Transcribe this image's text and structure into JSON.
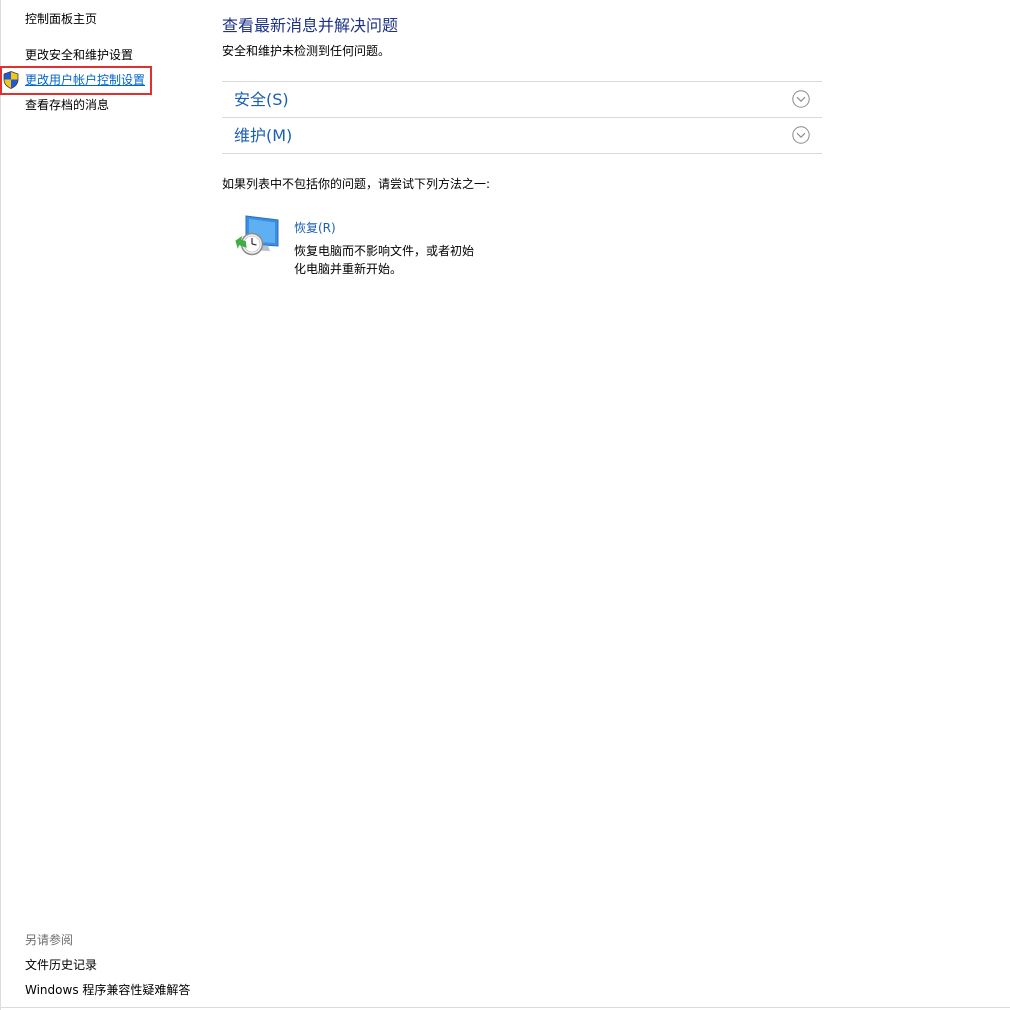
{
  "nav": {
    "home": "控制面板主页",
    "security_settings": "更改安全和维护设置",
    "uac_settings": "更改用户帐户控制设置",
    "archived_messages": "查看存档的消息"
  },
  "see_also": {
    "title": "另请参阅",
    "items": [
      "文件历史记录",
      "Windows 程序兼容性疑难解答"
    ]
  },
  "main": {
    "title": "查看最新消息并解决问题",
    "subtitle": "安全和维护未检测到任何问题。",
    "sections": [
      {
        "label": "安全(S)"
      },
      {
        "label": "维护(M)"
      }
    ],
    "help_text": "如果列表中不包括你的问题，请尝试下列方法之一:",
    "recovery": {
      "link": "恢复(R)",
      "description": "恢复电脑而不影响文件，或者初始化电脑并重新开始。"
    }
  },
  "colors": {
    "link": "#1a5fb4",
    "title": "#1e3287",
    "highlight": "#e0312f",
    "muted": "#6d6d6d"
  },
  "icons": {
    "uac": "uac-shield-icon",
    "expand": "chevron-down-circle-icon",
    "recovery": "recovery-monitor-clock-icon"
  }
}
